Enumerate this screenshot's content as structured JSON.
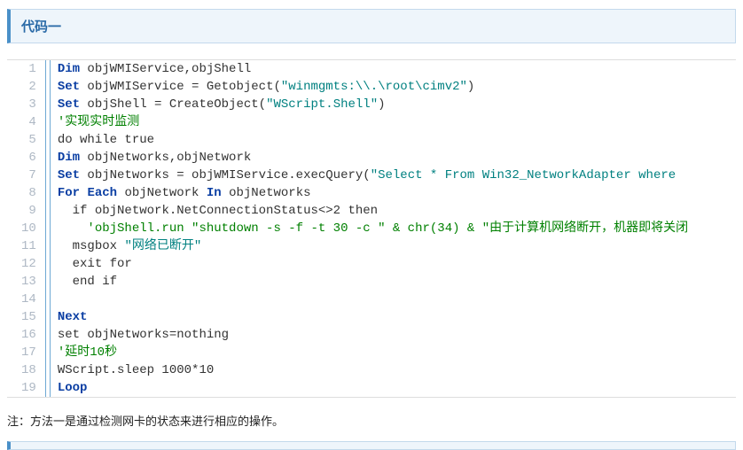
{
  "header": {
    "title": "代码一"
  },
  "code": {
    "lines": [
      {
        "n": 1,
        "ind": 0,
        "tokens": [
          {
            "c": "kw",
            "t": "Dim"
          },
          {
            "c": "txt",
            "t": " objWMIService,objShell"
          }
        ]
      },
      {
        "n": 2,
        "ind": 0,
        "tokens": [
          {
            "c": "kw",
            "t": "Set"
          },
          {
            "c": "txt",
            "t": " objWMIService = Getobject("
          },
          {
            "c": "str",
            "t": "\"winmgmts:\\\\.\\root\\cimv2\""
          },
          {
            "c": "txt",
            "t": ")"
          }
        ]
      },
      {
        "n": 3,
        "ind": 0,
        "tokens": [
          {
            "c": "kw",
            "t": "Set"
          },
          {
            "c": "txt",
            "t": " objShell = CreateObject("
          },
          {
            "c": "str",
            "t": "\"WScript.Shell\""
          },
          {
            "c": "txt",
            "t": ")"
          }
        ]
      },
      {
        "n": 4,
        "ind": 0,
        "tokens": [
          {
            "c": "cmt",
            "t": "'实现实时监测"
          }
        ]
      },
      {
        "n": 5,
        "ind": 0,
        "tokens": [
          {
            "c": "txt",
            "t": "do while true"
          }
        ]
      },
      {
        "n": 6,
        "ind": 0,
        "tokens": [
          {
            "c": "kw",
            "t": "Dim"
          },
          {
            "c": "txt",
            "t": " objNetworks,objNetwork"
          }
        ]
      },
      {
        "n": 7,
        "ind": 0,
        "tokens": [
          {
            "c": "kw",
            "t": "Set"
          },
          {
            "c": "txt",
            "t": " objNetworks = objWMIService.execQuery("
          },
          {
            "c": "str",
            "t": "\"Select * From Win32_NetworkAdapter where "
          }
        ]
      },
      {
        "n": 8,
        "ind": 0,
        "tokens": [
          {
            "c": "kw",
            "t": "For"
          },
          {
            "c": "txt",
            "t": " "
          },
          {
            "c": "kw",
            "t": "Each"
          },
          {
            "c": "txt",
            "t": " objNetwork "
          },
          {
            "c": "kw",
            "t": "In"
          },
          {
            "c": "txt",
            "t": " objNetworks"
          }
        ]
      },
      {
        "n": 9,
        "ind": 1,
        "tokens": [
          {
            "c": "txt",
            "t": "if objNetwork.NetConnectionStatus<>2 then"
          }
        ]
      },
      {
        "n": 10,
        "ind": 2,
        "tokens": [
          {
            "c": "cmt",
            "t": "'objShell.run \"shutdown -s -f -t 30 -c \" & chr(34) & \"由于计算机网络断开，机器即将关闭"
          }
        ]
      },
      {
        "n": 11,
        "ind": 1,
        "tokens": [
          {
            "c": "txt",
            "t": "msgbox "
          },
          {
            "c": "str",
            "t": "\"网络已断开\""
          }
        ]
      },
      {
        "n": 12,
        "ind": 1,
        "tokens": [
          {
            "c": "txt",
            "t": "exit for"
          }
        ]
      },
      {
        "n": 13,
        "ind": 1,
        "tokens": [
          {
            "c": "txt",
            "t": "end if"
          }
        ]
      },
      {
        "n": 14,
        "ind": 0,
        "tokens": []
      },
      {
        "n": 15,
        "ind": 0,
        "tokens": [
          {
            "c": "kw",
            "t": "Next"
          }
        ]
      },
      {
        "n": 16,
        "ind": 0,
        "tokens": [
          {
            "c": "txt",
            "t": "set objNetworks=nothing"
          }
        ]
      },
      {
        "n": 17,
        "ind": 0,
        "tokens": [
          {
            "c": "cmt",
            "t": "'延时10秒"
          }
        ]
      },
      {
        "n": 18,
        "ind": 0,
        "tokens": [
          {
            "c": "txt",
            "t": "WScript.sleep 1000*10"
          }
        ]
      },
      {
        "n": 19,
        "ind": 0,
        "tokens": [
          {
            "c": "kw",
            "t": "Loop"
          }
        ]
      }
    ]
  },
  "note": {
    "text": "注：方法一是通过检测网卡的状态来进行相应的操作。"
  }
}
